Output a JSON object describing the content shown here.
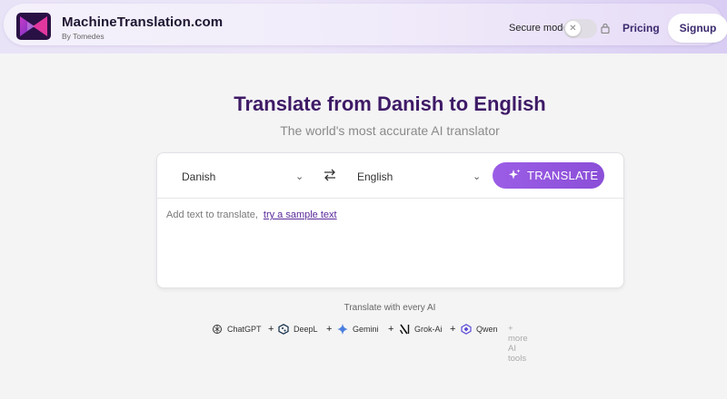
{
  "header": {
    "brand_name": "MachineTranslation.com",
    "brand_sub": "By Tomedes",
    "secure_mode_label": "Secure mode",
    "secure_toggle_state": "off",
    "pricing_label": "Pricing",
    "signup_label": "Signup"
  },
  "hero": {
    "title": "Translate from Danish to English",
    "subtitle": "The world's most accurate AI translator"
  },
  "translator": {
    "source_language": "Danish",
    "target_language": "English",
    "translate_button": "TRANSLATE",
    "placeholder": "Add text to translate,",
    "sample_link": "try a sample text"
  },
  "ai_tools": {
    "heading": "Translate with every AI",
    "items": [
      {
        "label": "ChatGPT",
        "icon": "chatgpt-icon"
      },
      {
        "label": "DeepL",
        "icon": "deepl-icon"
      },
      {
        "label": "Gemini",
        "icon": "gemini-icon"
      },
      {
        "label": "Grok-Ai",
        "icon": "grok-icon"
      },
      {
        "label": "Qwen",
        "icon": "qwen-icon"
      }
    ],
    "more_label": "+ more AI tools"
  },
  "colors": {
    "accent": "#9b5de5",
    "title": "#3e1a66",
    "brand_text": "#1d1530"
  }
}
